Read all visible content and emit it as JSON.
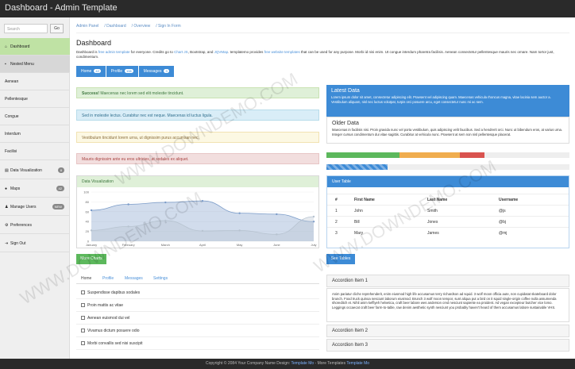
{
  "app": {
    "title": "Dashboard - Admin Template"
  },
  "sidebar": {
    "search_placeholder": "Search",
    "go_label": "Go",
    "items": [
      {
        "label": "Dashboard",
        "badge": "",
        "icon": "home-icon"
      },
      {
        "label": "Nested Menu",
        "badge": "",
        "icon": "folder-icon"
      },
      {
        "label": "Aenean",
        "badge": ""
      },
      {
        "label": "Pellentesque",
        "badge": ""
      },
      {
        "label": "Congue",
        "badge": ""
      },
      {
        "label": "Interdum",
        "badge": ""
      },
      {
        "label": "Facilisi",
        "badge": ""
      },
      {
        "label": "Data Visualization",
        "badge": "8",
        "icon": "chart-icon"
      },
      {
        "label": "Maps",
        "badge": "42",
        "icon": "map-pin-icon"
      },
      {
        "label": "Manage Users",
        "badge": "NEW",
        "icon": "users-icon"
      },
      {
        "label": "Preferences",
        "badge": "",
        "icon": "gear-icon"
      },
      {
        "label": "Sign Out",
        "badge": "",
        "icon": "signout-icon"
      }
    ]
  },
  "breadcrumb": [
    "Admin Panel",
    "Dashboard",
    "Overview",
    "Sign In Form"
  ],
  "page": {
    "title": "Dashboard",
    "desc_a": "Dashboard is ",
    "desc_link1": "free admin template",
    "desc_b": " for everyone. Credits go to ",
    "desc_link2": "Chart JS",
    "desc_c": ", Bootstrap, and ",
    "desc_link3": "JQVMap",
    "desc_d": ". templatemo provides ",
    "desc_link4": "free website templates",
    "desc_e": " that can be used for any purpose. Morbi id nisi enim. Ut congue interdum pharetra facilisis. Aenean consectetur pellentesque mauris nec ornare. Nam tortor just, condimentum."
  },
  "pills": [
    {
      "label": "Home",
      "num": "42"
    },
    {
      "label": "Profile",
      "num": "108"
    },
    {
      "label": "Messages",
      "num": "3"
    }
  ],
  "alerts": {
    "success_bold": "Success!",
    "success_text": " Maecenas nec lorem sed elit molestie tincidunt.",
    "info": "Sed in molestie lectus. Curabitur nec est neque. Maecenas id luctus ligula.",
    "warning": "Vestibulum tincidunt lorem urna, ut dignissim purus accumsan nec.",
    "danger": "Mauris dignissim ante eu eros ultricies, at sodales ex aliquet."
  },
  "chart_panel": {
    "title": "Data Visualization"
  },
  "chart_data": {
    "type": "line",
    "categories": [
      "January",
      "February",
      "March",
      "April",
      "May",
      "June",
      "July"
    ],
    "series": [
      {
        "values": [
          63,
          75,
          79,
          82,
          57,
          55,
          40
        ],
        "color": "#7a9bc8"
      },
      {
        "values": [
          22,
          30,
          42,
          21,
          22,
          14,
          50
        ],
        "color": "#b7c3d0"
      }
    ],
    "ylim": [
      0,
      100
    ],
    "yticks": [
      "100",
      "80",
      "60",
      "40",
      "20",
      "0"
    ]
  },
  "buttons": {
    "more_charts": "More Charts",
    "see_tables": "See Tables"
  },
  "tabs": [
    "Home",
    "Profile",
    "Messages",
    "Settings"
  ],
  "checks": [
    "Suspendisse dapibus sodales",
    "Proin mattis ac vitae",
    "Aenean euismod dui vel",
    "Vivamus dictum posuere odio",
    "Morbi convallis sed nisi suscipit"
  ],
  "latest": {
    "title": "Latest Data",
    "text": "Lorem ipsum dolor sit amet, consectetur adipiscing elit. Praesent vel adipiscing quam. Maecenas vehicula rhoncus magna, vitae lacinia sem auctor a. Vestibulum aliquam, nisl nec luctus volutpat, turpis orci posuere arcu, eget consectetur nunc mi ac sem."
  },
  "older": {
    "title": "Older Data",
    "text": "Maecenas in facilisis nisi. Proin gravida nunc vel porta vestibulum, quis adipiscing velit faucibus. Sed a hendrerit orci. Nunc ut bibendum eros, at varius urna. Integer cursus condimentum dui vitae sagittis. Curabitur at vehicula nunc. Praesent at sem non nisl pellentesque placerat."
  },
  "table": {
    "title": "User Table",
    "headers": [
      "#",
      "First Name",
      "Last Name",
      "Username"
    ],
    "rows": [
      [
        "1",
        "John",
        "Smith",
        "@js"
      ],
      [
        "2",
        "Bill",
        "Jones",
        "@bj"
      ],
      [
        "3",
        "Mary",
        "James",
        "@mj"
      ]
    ]
  },
  "accordion": {
    "items": [
      "Accordion Item 1",
      "Accordion Item 2",
      "Accordion Item 3"
    ],
    "body": "Anim pariatur cliche reprehenderit, enim eiusmod high life accusamus terry richardson ad squid. 3 wolf moon officia aute, non cupidatat skateboard dolor brunch. Food truck quinoa nesciunt laborum eiusmod. Brunch 3 wolf moon tempor, sunt aliqua put a bird on it squid single-origin coffee nulla assumenda shoreditch et. Nihil anim keffiyeh helvetica, craft beer labore wes anderson cred nesciunt sapiente ea proident. Ad vegan excepteur butcher vice lomo. Leggings occaecat craft beer farm-to-table, raw denim aesthetic synth nesciunt you probably haven't heard of them accusamus labore sustainable VHS."
  },
  "footer": {
    "text_a": "Copyright © 2084 Your Company Name  Design: ",
    "link1": "Template Mo",
    "text_b": " - More Templates ",
    "link2": "Template Mo"
  },
  "watermark": "WWW.DOWNDEMO.COM",
  "colors": {
    "primary": "#3d8bd6",
    "success": "#5cb85c",
    "topbar": "#2a2a2a"
  }
}
